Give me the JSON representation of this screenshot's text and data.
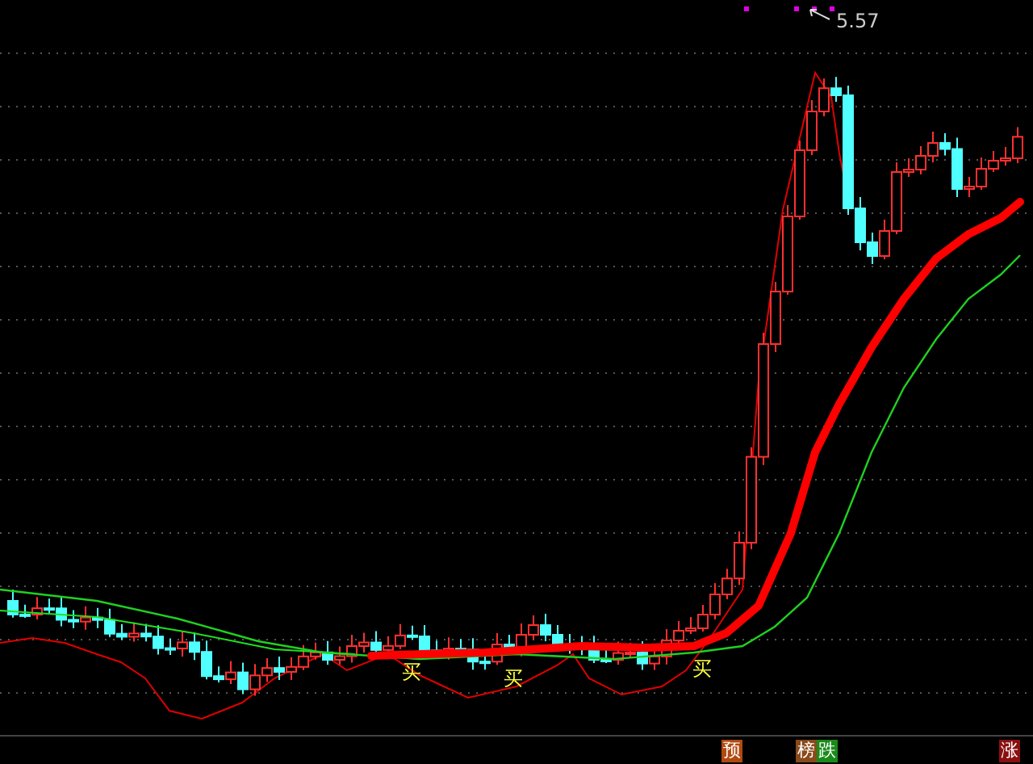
{
  "chart": {
    "peak_label": "5.57",
    "buy_signals": [
      {
        "label": "买"
      },
      {
        "label": "买"
      },
      {
        "label": "买"
      }
    ]
  },
  "bottom_tags": [
    {
      "label": "预",
      "color": "#b04a10"
    },
    {
      "label": "榜",
      "color": "#8a4a1a"
    },
    {
      "label": "跌",
      "color": "#1a8a1a"
    },
    {
      "label": "涨",
      "color": "#8a1010"
    }
  ]
}
